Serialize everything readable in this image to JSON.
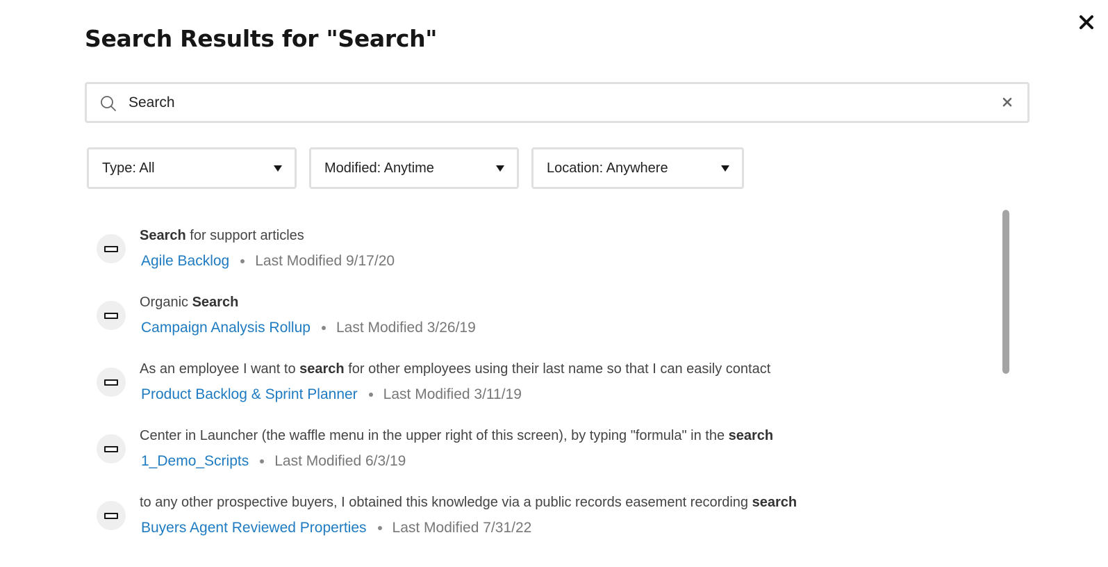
{
  "dialog": {
    "title": "Search Results for \"Search\"",
    "close_icon": "close-icon"
  },
  "search": {
    "value": "Search",
    "placeholder": "Search",
    "search_icon": "search-icon",
    "clear_icon": "clear-icon"
  },
  "filters": [
    {
      "label": "Type: All",
      "icon": "caret-down-icon"
    },
    {
      "label": "Modified: Anytime",
      "icon": "caret-down-icon"
    },
    {
      "label": "Location: Anywhere",
      "icon": "caret-down-icon"
    }
  ],
  "results": [
    {
      "icon": "sheet-icon",
      "snippet_pre": "",
      "snippet_bold": "Search",
      "snippet_post": " for support articles",
      "sheet": "Agile Backlog",
      "modified": "Last Modified 9/17/20"
    },
    {
      "icon": "sheet-icon",
      "snippet_pre": "Organic ",
      "snippet_bold": "Search",
      "snippet_post": "",
      "sheet": "Campaign Analysis Rollup",
      "modified": "Last Modified 3/26/19"
    },
    {
      "icon": "sheet-icon",
      "snippet_pre": "As an employee I want to ",
      "snippet_bold": "search",
      "snippet_post": " for other employees using their last name so that I can easily contact",
      "sheet": "Product Backlog & Sprint Planner",
      "modified": "Last Modified 3/11/19"
    },
    {
      "icon": "sheet-icon",
      "snippet_pre": "Center in Launcher (the waffle menu in the upper right of this screen), by typing \"formula\" in the ",
      "snippet_bold": "search",
      "snippet_post": "",
      "sheet": "1_Demo_Scripts",
      "modified": "Last Modified 6/3/19"
    },
    {
      "icon": "sheet-icon",
      "snippet_pre": "to any other prospective buyers, I obtained this knowledge via a public records easement recording ",
      "snippet_bold": "search",
      "snippet_post": "",
      "sheet": "Buyers Agent Reviewed Properties",
      "modified": "Last Modified 7/31/22"
    }
  ],
  "colors": {
    "link": "#1f7bc1",
    "icon_bg": "#efefef",
    "border": "#e0e0e0",
    "scrollbar": "#a4a4a4"
  }
}
